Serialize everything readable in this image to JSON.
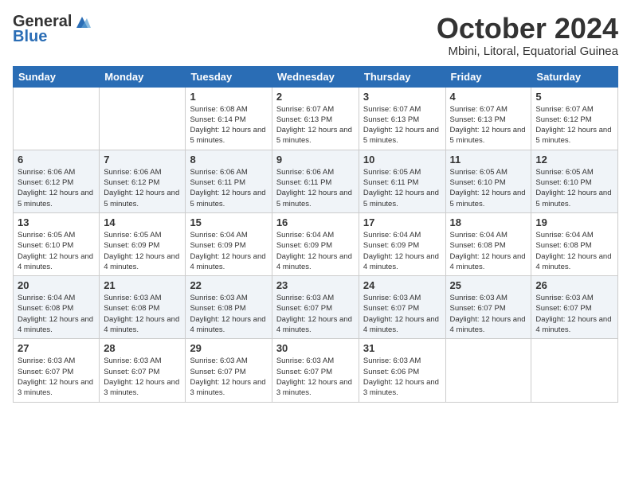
{
  "logo": {
    "general": "General",
    "blue": "Blue"
  },
  "title": "October 2024",
  "subtitle": "Mbini, Litoral, Equatorial Guinea",
  "weekdays": [
    "Sunday",
    "Monday",
    "Tuesday",
    "Wednesday",
    "Thursday",
    "Friday",
    "Saturday"
  ],
  "weeks": [
    [
      {
        "day": "",
        "info": ""
      },
      {
        "day": "",
        "info": ""
      },
      {
        "day": "1",
        "info": "Sunrise: 6:08 AM\nSunset: 6:14 PM\nDaylight: 12 hours and 5 minutes."
      },
      {
        "day": "2",
        "info": "Sunrise: 6:07 AM\nSunset: 6:13 PM\nDaylight: 12 hours and 5 minutes."
      },
      {
        "day": "3",
        "info": "Sunrise: 6:07 AM\nSunset: 6:13 PM\nDaylight: 12 hours and 5 minutes."
      },
      {
        "day": "4",
        "info": "Sunrise: 6:07 AM\nSunset: 6:13 PM\nDaylight: 12 hours and 5 minutes."
      },
      {
        "day": "5",
        "info": "Sunrise: 6:07 AM\nSunset: 6:12 PM\nDaylight: 12 hours and 5 minutes."
      }
    ],
    [
      {
        "day": "6",
        "info": "Sunrise: 6:06 AM\nSunset: 6:12 PM\nDaylight: 12 hours and 5 minutes."
      },
      {
        "day": "7",
        "info": "Sunrise: 6:06 AM\nSunset: 6:12 PM\nDaylight: 12 hours and 5 minutes."
      },
      {
        "day": "8",
        "info": "Sunrise: 6:06 AM\nSunset: 6:11 PM\nDaylight: 12 hours and 5 minutes."
      },
      {
        "day": "9",
        "info": "Sunrise: 6:06 AM\nSunset: 6:11 PM\nDaylight: 12 hours and 5 minutes."
      },
      {
        "day": "10",
        "info": "Sunrise: 6:05 AM\nSunset: 6:11 PM\nDaylight: 12 hours and 5 minutes."
      },
      {
        "day": "11",
        "info": "Sunrise: 6:05 AM\nSunset: 6:10 PM\nDaylight: 12 hours and 5 minutes."
      },
      {
        "day": "12",
        "info": "Sunrise: 6:05 AM\nSunset: 6:10 PM\nDaylight: 12 hours and 5 minutes."
      }
    ],
    [
      {
        "day": "13",
        "info": "Sunrise: 6:05 AM\nSunset: 6:10 PM\nDaylight: 12 hours and 4 minutes."
      },
      {
        "day": "14",
        "info": "Sunrise: 6:05 AM\nSunset: 6:09 PM\nDaylight: 12 hours and 4 minutes."
      },
      {
        "day": "15",
        "info": "Sunrise: 6:04 AM\nSunset: 6:09 PM\nDaylight: 12 hours and 4 minutes."
      },
      {
        "day": "16",
        "info": "Sunrise: 6:04 AM\nSunset: 6:09 PM\nDaylight: 12 hours and 4 minutes."
      },
      {
        "day": "17",
        "info": "Sunrise: 6:04 AM\nSunset: 6:09 PM\nDaylight: 12 hours and 4 minutes."
      },
      {
        "day": "18",
        "info": "Sunrise: 6:04 AM\nSunset: 6:08 PM\nDaylight: 12 hours and 4 minutes."
      },
      {
        "day": "19",
        "info": "Sunrise: 6:04 AM\nSunset: 6:08 PM\nDaylight: 12 hours and 4 minutes."
      }
    ],
    [
      {
        "day": "20",
        "info": "Sunrise: 6:04 AM\nSunset: 6:08 PM\nDaylight: 12 hours and 4 minutes."
      },
      {
        "day": "21",
        "info": "Sunrise: 6:03 AM\nSunset: 6:08 PM\nDaylight: 12 hours and 4 minutes."
      },
      {
        "day": "22",
        "info": "Sunrise: 6:03 AM\nSunset: 6:08 PM\nDaylight: 12 hours and 4 minutes."
      },
      {
        "day": "23",
        "info": "Sunrise: 6:03 AM\nSunset: 6:07 PM\nDaylight: 12 hours and 4 minutes."
      },
      {
        "day": "24",
        "info": "Sunrise: 6:03 AM\nSunset: 6:07 PM\nDaylight: 12 hours and 4 minutes."
      },
      {
        "day": "25",
        "info": "Sunrise: 6:03 AM\nSunset: 6:07 PM\nDaylight: 12 hours and 4 minutes."
      },
      {
        "day": "26",
        "info": "Sunrise: 6:03 AM\nSunset: 6:07 PM\nDaylight: 12 hours and 4 minutes."
      }
    ],
    [
      {
        "day": "27",
        "info": "Sunrise: 6:03 AM\nSunset: 6:07 PM\nDaylight: 12 hours and 3 minutes."
      },
      {
        "day": "28",
        "info": "Sunrise: 6:03 AM\nSunset: 6:07 PM\nDaylight: 12 hours and 3 minutes."
      },
      {
        "day": "29",
        "info": "Sunrise: 6:03 AM\nSunset: 6:07 PM\nDaylight: 12 hours and 3 minutes."
      },
      {
        "day": "30",
        "info": "Sunrise: 6:03 AM\nSunset: 6:07 PM\nDaylight: 12 hours and 3 minutes."
      },
      {
        "day": "31",
        "info": "Sunrise: 6:03 AM\nSunset: 6:06 PM\nDaylight: 12 hours and 3 minutes."
      },
      {
        "day": "",
        "info": ""
      },
      {
        "day": "",
        "info": ""
      }
    ]
  ]
}
